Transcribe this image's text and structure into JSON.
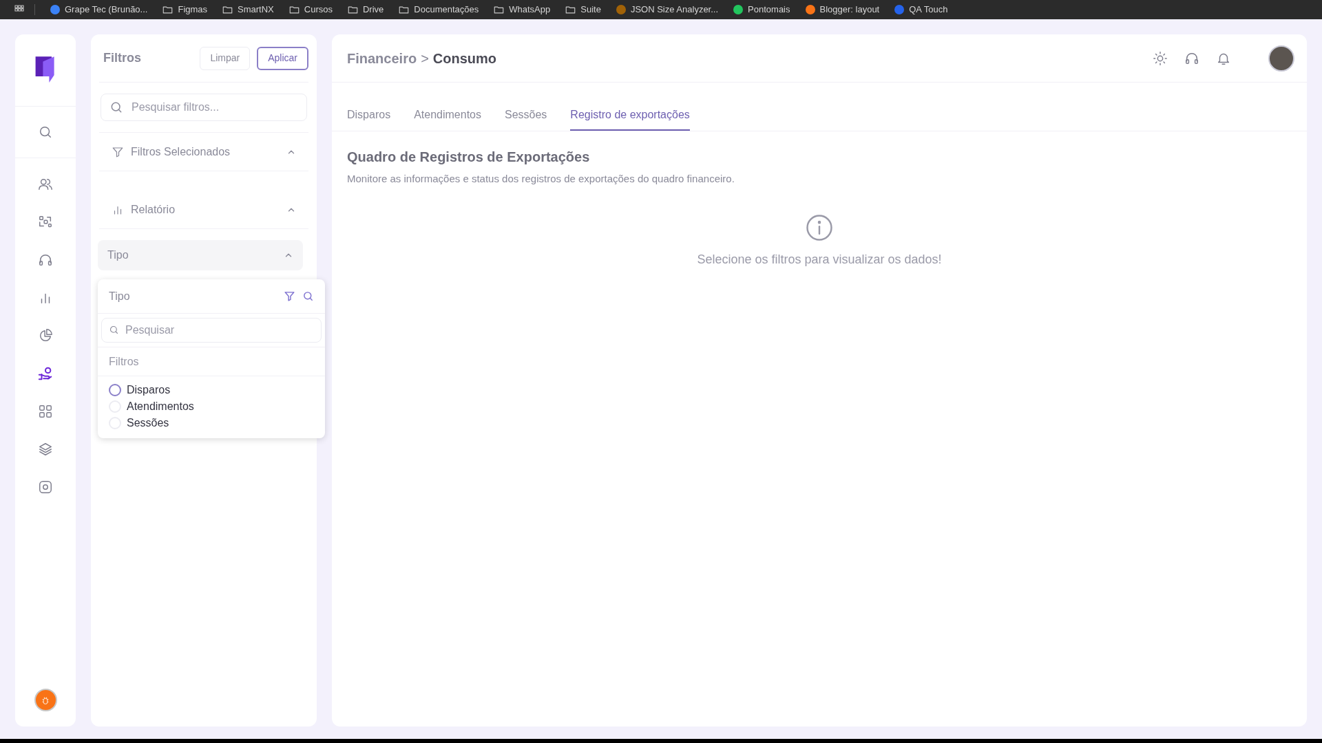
{
  "bookmarks": [
    {
      "label": "Grape Tec (Brunão...",
      "kind": "site",
      "color": "#3b82f6"
    },
    {
      "label": "Figmas",
      "kind": "folder"
    },
    {
      "label": "SmartNX",
      "kind": "folder"
    },
    {
      "label": "Cursos",
      "kind": "folder"
    },
    {
      "label": "Drive",
      "kind": "folder"
    },
    {
      "label": "Documentações",
      "kind": "folder"
    },
    {
      "label": "WhatsApp",
      "kind": "folder"
    },
    {
      "label": "Suite",
      "kind": "folder"
    },
    {
      "label": "JSON Size Analyzer...",
      "kind": "site",
      "color": "#a16207"
    },
    {
      "label": "Pontomais",
      "kind": "site",
      "color": "#22c55e"
    },
    {
      "label": "Blogger: layout",
      "kind": "site",
      "color": "#f97316"
    },
    {
      "label": "QA Touch",
      "kind": "site",
      "color": "#2563eb"
    }
  ],
  "nav": [
    {
      "selected": false
    },
    {
      "selected": false
    },
    {
      "selected": false
    },
    {
      "selected": false
    },
    {
      "selected": false
    },
    {
      "selected": false
    },
    {
      "selected": true
    },
    {
      "selected": false
    },
    {
      "selected": false
    },
    {
      "selected": false
    }
  ],
  "filters": {
    "title": "Filtros",
    "clear_button": "Limpar",
    "apply_button": "Aplicar",
    "search": {
      "placeholder": "Pesquisar filtros..."
    },
    "sections": [
      {
        "label": "Filtros Selecionados",
        "expanded": true
      },
      {
        "label": "Relatório",
        "expanded": true
      }
    ],
    "dropdown": {
      "label": "Tipo",
      "expanded": true,
      "popup": {
        "title": "Tipo",
        "search": {
          "placeholder": "Pesquisar"
        },
        "group_label": "Filtros",
        "options": [
          {
            "label": "Disparos",
            "checked": false
          },
          {
            "label": "Atendimentos",
            "checked": false
          },
          {
            "label": "Sessões",
            "checked": false
          }
        ]
      }
    }
  },
  "header": {
    "breadcrumb_parent": "Financeiro",
    "breadcrumb_separator": ">",
    "breadcrumb_current": "Consumo"
  },
  "tabs": [
    {
      "label": "Disparos",
      "selected": false
    },
    {
      "label": "Atendimentos",
      "selected": false
    },
    {
      "label": "Sessões",
      "selected": false
    },
    {
      "label": "Registro de exportações",
      "selected": true
    }
  ],
  "section": {
    "title": "Quadro de Registros de Exportações",
    "subtitle": "Monitore as informações e status dos registros de exportações do quadro financeiro."
  },
  "empty_state": {
    "message": "Selecione os filtros para visualizar os dados!"
  }
}
